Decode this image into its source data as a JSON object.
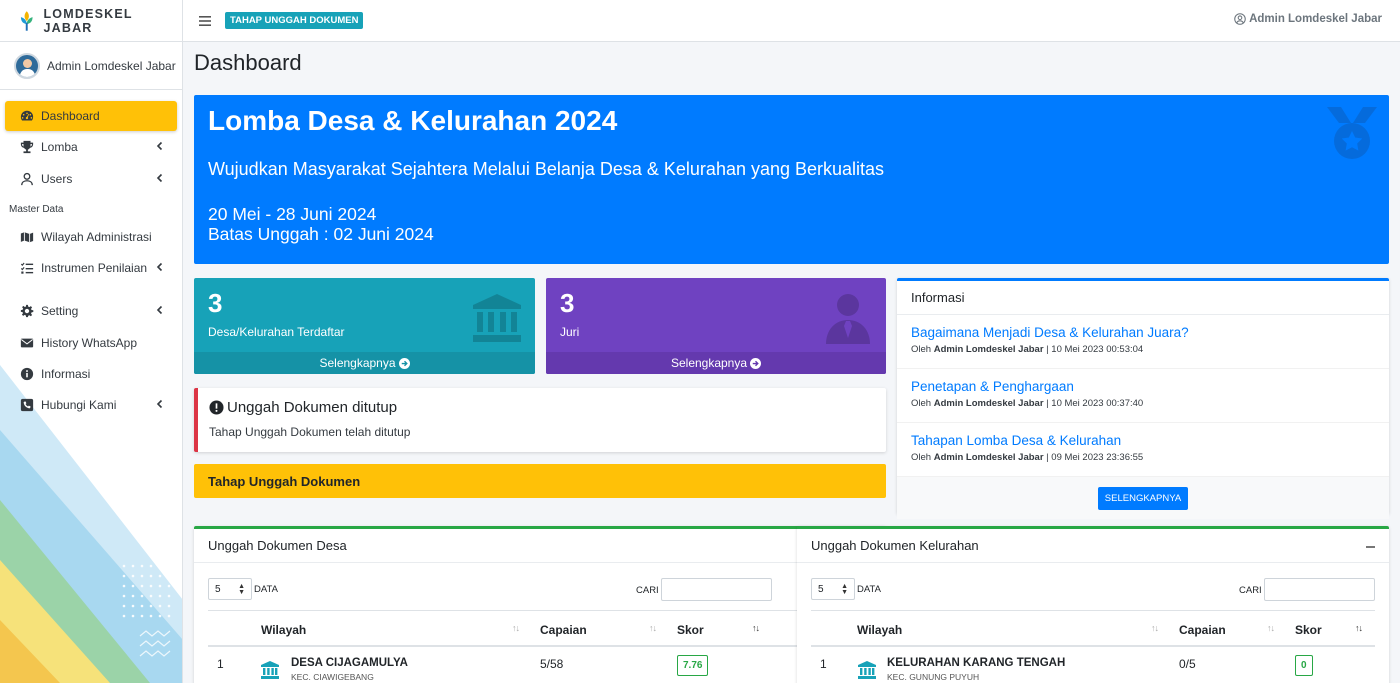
{
  "brand": {
    "name": "LOMDESKEL JABAR"
  },
  "sidebar": {
    "user": "Admin Lomdeskel Jabar",
    "items": [
      {
        "label": "Dashboard",
        "icon": "dashboard-icon",
        "active": true
      },
      {
        "label": "Lomba",
        "icon": "trophy-icon",
        "has_children": true
      },
      {
        "label": "Users",
        "icon": "user-icon",
        "has_children": true
      }
    ],
    "master_header": "Master Data",
    "master_items": [
      {
        "label": "Wilayah Administrasi",
        "icon": "map-icon"
      },
      {
        "label": "Instrumen Penilaian",
        "icon": "list-check-icon",
        "has_children": true
      }
    ],
    "bottom_items": [
      {
        "label": "Setting",
        "icon": "gear-icon",
        "has_children": true
      },
      {
        "label": "History WhatsApp",
        "icon": "envelope-icon"
      },
      {
        "label": "Informasi",
        "icon": "info-circle-icon"
      },
      {
        "label": "Hubungi Kami",
        "icon": "phone-square-icon",
        "has_children": true
      }
    ]
  },
  "topbar": {
    "stage_badge": "TAHAP UNGGAH DOKUMEN",
    "user": "Admin Lomdeskel Jabar"
  },
  "page": {
    "title": "Dashboard"
  },
  "hero": {
    "title": "Lomba Desa & Kelurahan 2024",
    "subtitle": "Wujudkan Masyarakat Sejahtera Melalui Belanja Desa & Kelurahan yang Berkualitas",
    "dates": "20 Mei - 28 Juni 2024",
    "deadline": "Batas Unggah : 02 Juni 2024"
  },
  "stats": {
    "desa": {
      "count": "3",
      "label": "Desa/Kelurahan Terdaftar",
      "link": "Selengkapnya",
      "color": "#17a2b8"
    },
    "juri": {
      "count": "3",
      "label": "Juri",
      "link": "Selengkapnya",
      "color": "#6f42c1"
    }
  },
  "callout": {
    "title": "Unggah Dokumen ditutup",
    "text": "Tahap Unggah Dokumen telah ditutup"
  },
  "stage_bar": {
    "label": "Tahap Unggah Dokumen"
  },
  "informasi": {
    "title": "Informasi",
    "items": [
      {
        "title": "Bagaimana Menjadi Desa & Kelurahan Juara?",
        "by": "Oleh",
        "author": "Admin Lomdeskel Jabar",
        "date": "| 10 Mei 2023 00:53:04"
      },
      {
        "title": "Penetapan & Penghargaan",
        "by": "Oleh",
        "author": "Admin Lomdeskel Jabar",
        "date": "| 10 Mei 2023 00:37:40"
      },
      {
        "title": "Tahapan Lomba Desa & Kelurahan",
        "by": "Oleh",
        "author": "Admin Lomdeskel Jabar",
        "date": "| 09 Mei 2023 23:36:55"
      }
    ],
    "button": "SELENGKAPNYA"
  },
  "desa_table": {
    "title": "Unggah Dokumen Desa",
    "length_value": "5",
    "length_label": "DATA",
    "search_label": "CARI",
    "columns": [
      "Wilayah",
      "Capaian",
      "Skor"
    ],
    "rows": [
      {
        "no": "1",
        "name": "DESA CIJAGAMULYA",
        "kec": "KEC. CIAWIGEBANG",
        "capaian": "5/58",
        "skor": "7.76"
      }
    ]
  },
  "kelurahan_table": {
    "title": "Unggah Dokumen Kelurahan",
    "length_value": "5",
    "length_label": "DATA",
    "search_label": "CARI",
    "columns": [
      "Wilayah",
      "Capaian",
      "Skor"
    ],
    "rows": [
      {
        "no": "1",
        "name": "KELURAHAN KARANG TENGAH",
        "kec": "KEC. GUNUNG PUYUH",
        "capaian": "0/5",
        "skor": "0"
      }
    ]
  },
  "colors": {
    "primary": "#007bff",
    "warning": "#ffc107",
    "info": "#17a2b8",
    "purple": "#6f42c1",
    "danger": "#dc3545",
    "success": "#28a745"
  }
}
